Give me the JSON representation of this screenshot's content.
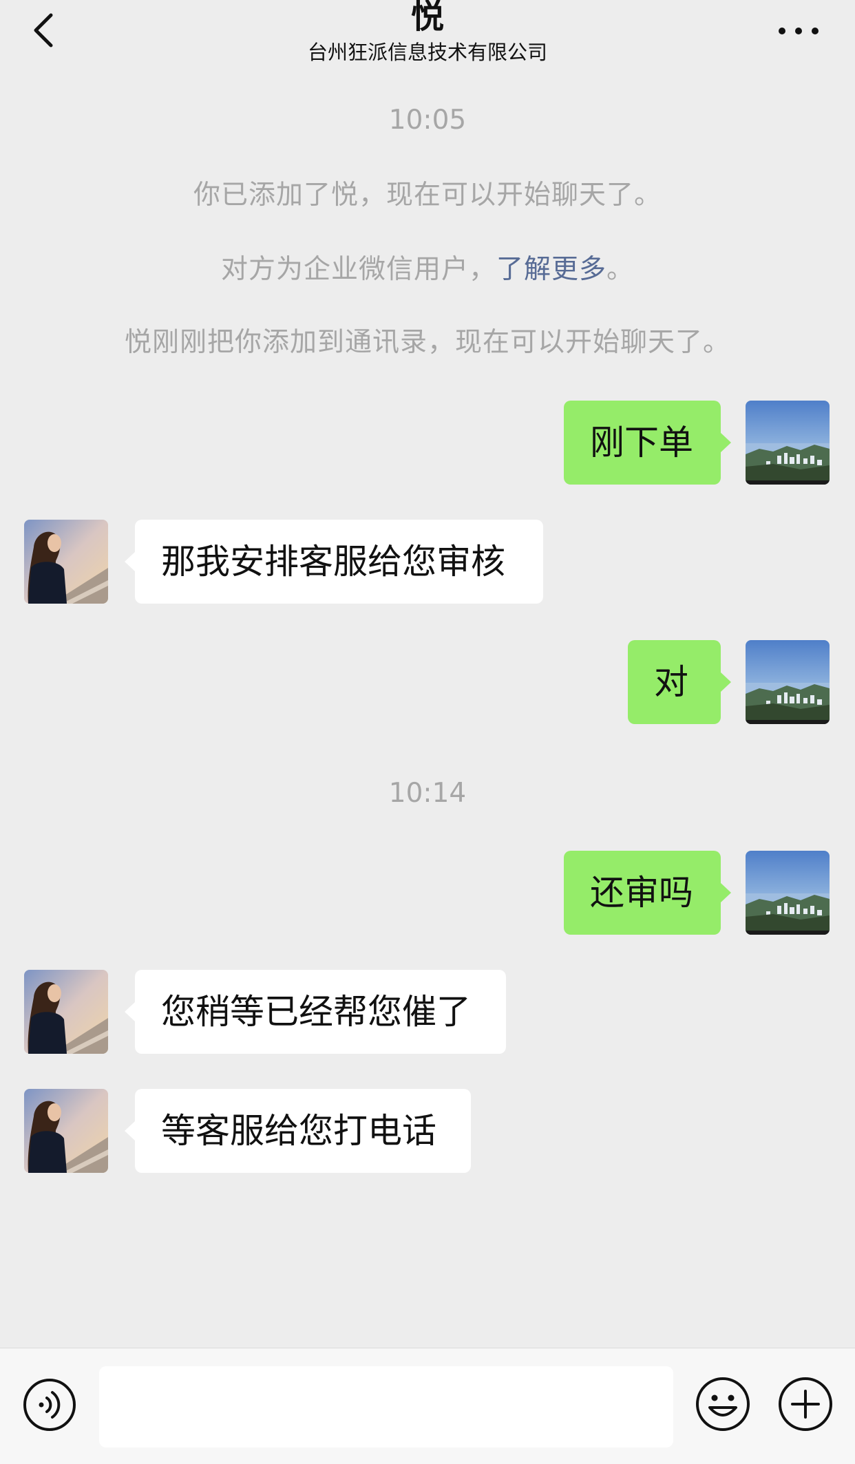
{
  "header": {
    "title": "悦",
    "subtitle": "台州狂派信息技术有限公司"
  },
  "timestamps": [
    "10:05",
    "10:14"
  ],
  "system_messages": {
    "added": "你已添加了悦，现在可以开始聊天了。",
    "enterprise_prefix": "对方为企业微信用户，",
    "enterprise_link": "了解更多",
    "enterprise_suffix": "。",
    "contact_added": "悦刚刚把你添加到通讯录，现在可以开始聊天了。"
  },
  "messages": [
    {
      "from": "me",
      "text": "刚下单"
    },
    {
      "from": "them",
      "text": "那我安排客服给您审核"
    },
    {
      "from": "me",
      "text": "对"
    },
    {
      "from": "me",
      "text": "还审吗"
    },
    {
      "from": "them",
      "text": "您稍等已经帮您催了"
    },
    {
      "from": "them",
      "text": "等客服给您打电话"
    }
  ],
  "input": {
    "value": ""
  },
  "colors": {
    "background": "#ededed",
    "my_bubble": "#95ec69",
    "their_bubble": "#ffffff",
    "system_text": "#a6a6a6",
    "link": "#576b95"
  },
  "icons": [
    "back-arrow-icon",
    "more-icon",
    "voice-icon",
    "emoji-icon",
    "plus-icon"
  ]
}
